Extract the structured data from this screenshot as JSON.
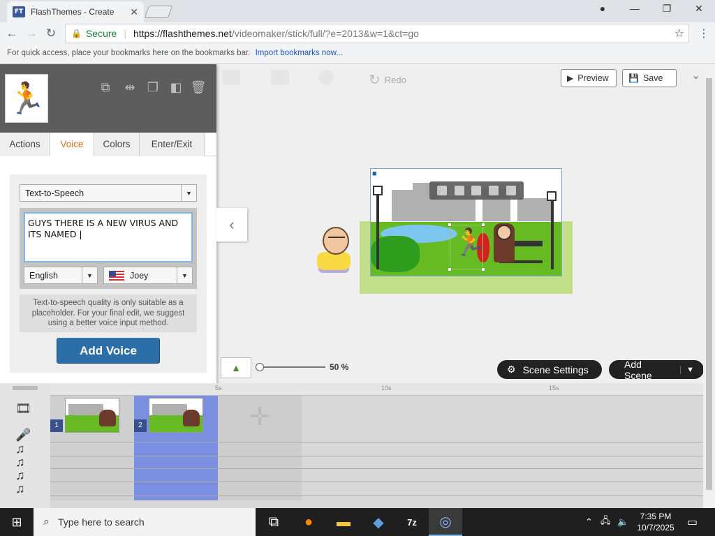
{
  "browser": {
    "tab_title": "FlashThemes - Create",
    "tab_favicon": "FT",
    "tab_close": "✕",
    "url_secure_label": "Secure",
    "url_host": "https://flashthemes.net",
    "url_path": "/videomaker/stick/full/?e=2013&w=1&ct=go",
    "bookmarks_text": "For quick access, place your bookmarks here on the bookmarks bar.",
    "bookmarks_link": "Import bookmarks now..."
  },
  "toolbar": {
    "redo_label": "Redo",
    "preview_label": "Preview",
    "save_label": "Save"
  },
  "panel": {
    "tabs": [
      "Actions",
      "Voice",
      "Colors",
      "Enter/Exit"
    ],
    "active_tab": "Voice",
    "voice_mode": "Text-to-Speech",
    "tts_text": "GUYS THERE IS A NEW VIRUS AND ITS NAMED |",
    "language": "English",
    "voice_name": "Joey",
    "note": "Text-to-speech quality is only suitable as a placeholder. For your final edit, we suggest using a better voice input method.",
    "add_voice_label": "Add Voice"
  },
  "stage": {
    "zoom_level": "50 %",
    "scene_settings_label": "Scene Settings",
    "add_scene_label": "Add Scene"
  },
  "timeline": {
    "ruler_ticks": [
      "5s",
      "10s",
      "15s"
    ],
    "scenes": [
      {
        "number": "1"
      },
      {
        "number": "2"
      }
    ]
  },
  "taskbar": {
    "search_placeholder": "Type here to search",
    "time": "7:35 PM",
    "date": "10/7/2025"
  },
  "colors": {
    "active_tab": "#d86f1c",
    "add_voice": "#2c6ea8",
    "selected_scene": "#7a8fe0",
    "grass": "#66bb22"
  }
}
